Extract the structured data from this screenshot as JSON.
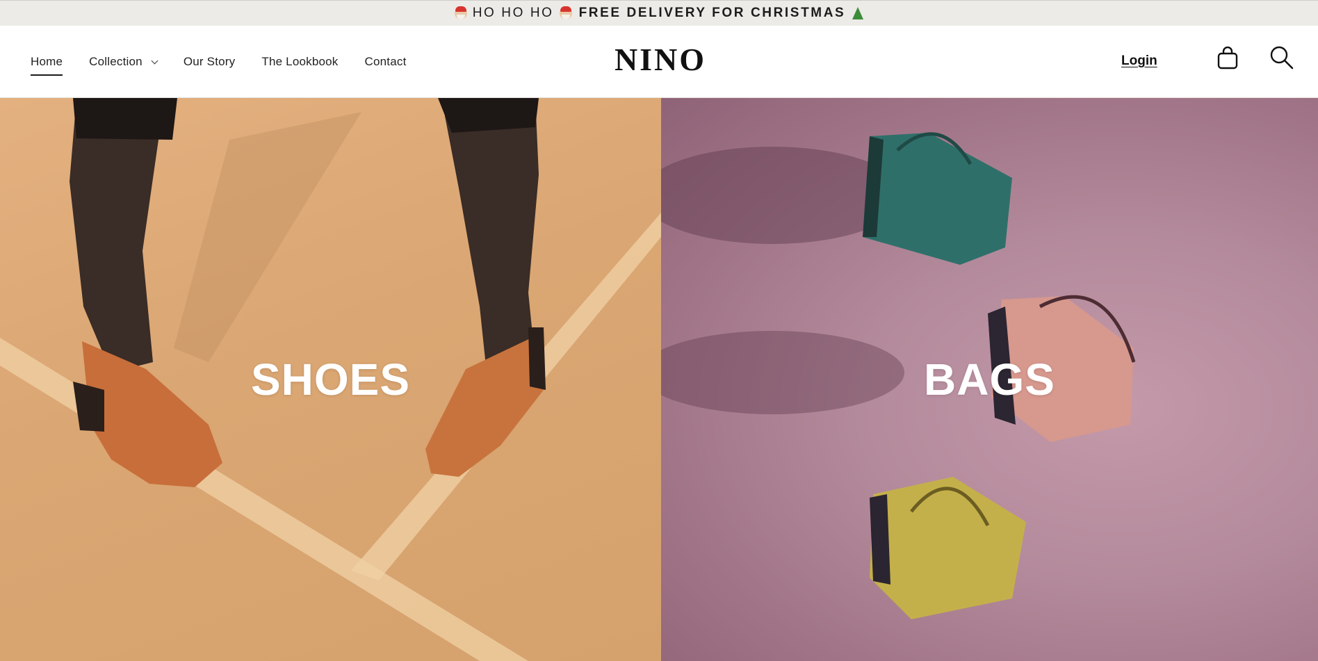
{
  "announcement": {
    "text_a": "HO HO HO",
    "text_b": "FREE DELIVERY FOR CHRISTMAS",
    "icons": [
      "santa-emoji",
      "santa-emoji",
      "christmas-tree-emoji"
    ]
  },
  "header": {
    "nav": [
      {
        "label": "Home",
        "active": true
      },
      {
        "label": "Collection",
        "has_dropdown": true
      },
      {
        "label": "Our Story"
      },
      {
        "label": "The Lookbook"
      },
      {
        "label": "Contact"
      }
    ],
    "logo": "NINO",
    "login_label": "Login",
    "icons": [
      "cart-icon",
      "search-icon"
    ]
  },
  "hero": {
    "panels": [
      {
        "title": "SHOES",
        "background": "#daa673"
      },
      {
        "title": "BAGS",
        "background": "#b38a9b"
      }
    ]
  },
  "colors": {
    "announcement_bg": "#ecebe8",
    "header_bg": "#ffffff",
    "text": "#1a1a1a"
  }
}
